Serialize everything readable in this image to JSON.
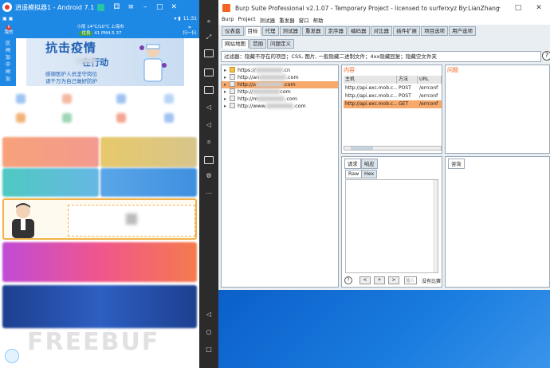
{
  "emulator": {
    "title": "逍遥模拟器1 - Android 7.1",
    "status_time": "11:31",
    "appbar_left_label": "我的",
    "appbar_left_badge": "6",
    "location_line1": "小雨 14℃/10℃ 上海市",
    "location_badge": "优良",
    "location_line2": "41 PM4.5 37",
    "appbar_right_label": "扫一扫",
    "sidebar_lines": [
      "区",
      "闸",
      "加",
      "中",
      "闸",
      "加"
    ],
    "banner_title": "抗击疫情",
    "banner_sub": "在行动",
    "banner_line1": "感谢医护人员坚守岗位",
    "banner_line2": "请千万为自己做好防护"
  },
  "burp": {
    "title": "Burp Suite Professional v2.1.07 - Temporary Project - licensed to surferxyz By:LianZhang",
    "menu": [
      "Burp",
      "Project",
      "测试器",
      "重发器",
      "窗口",
      "帮助"
    ],
    "tabs": [
      "仪表盘",
      "目标",
      "代理",
      "测试器",
      "重发器",
      "定序器",
      "编码器",
      "对比器",
      "插件扩展",
      "项目选项",
      "用户选项"
    ],
    "active_tab": "目标",
    "subtabs": [
      "网站地图",
      "范围",
      "问题定义"
    ],
    "filter_text": "过滤器：隐藏不存在的项目；CSS, 图片, 一般隐藏二进制文件；4xx隐藏回复；隐藏空文件夹",
    "tree_items": [
      {
        "prefix": "https://",
        "suffix": ".cn"
      },
      {
        "prefix": "http://an",
        "suffix": ".com"
      },
      {
        "prefix": "http://a",
        "suffix": ".com"
      },
      {
        "prefix": "http://",
        "suffix": "com"
      },
      {
        "prefix": "http://m",
        "suffix": ".com"
      },
      {
        "prefix": "http://www.",
        "suffix": ".com"
      }
    ],
    "content_heading": "内容",
    "issues_heading": "问题",
    "table_headers": [
      "主机",
      "方法",
      "URL"
    ],
    "table_rows": [
      {
        "host": "http://api.exc.mob.c...",
        "method": "POST",
        "url": "/errconf"
      },
      {
        "host": "http://api.exc.mob.c...",
        "method": "POST",
        "url": "/errconf"
      },
      {
        "host": "http://api.exc.mob.c...",
        "method": "GET",
        "url": "/errconf"
      }
    ],
    "req_tabs": [
      "请求",
      "响应"
    ],
    "raw_tabs": [
      "Raw",
      "Hex"
    ],
    "advice_tab": "咨询",
    "search_placeholder": "输入",
    "no_match": "没有比赛",
    "nav_buttons": [
      "<",
      "+",
      ">"
    ]
  },
  "watermark": "FREEBUF"
}
